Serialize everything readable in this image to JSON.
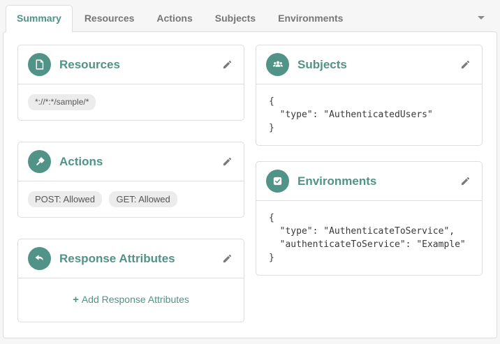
{
  "colors": {
    "accent": "#519387",
    "tab_inactive": "#767676",
    "badge_bg": "#ececec",
    "panel_bg": "#ffffff",
    "page_bg": "#f6f6f6"
  },
  "tabs": [
    {
      "label": "Summary",
      "active": true
    },
    {
      "label": "Resources",
      "active": false
    },
    {
      "label": "Actions",
      "active": false
    },
    {
      "label": "Subjects",
      "active": false
    },
    {
      "label": "Environments",
      "active": false
    }
  ],
  "tab_overflow_icon": "chevron-down-icon",
  "cards": {
    "resources": {
      "title": "Resources",
      "icon": "file-icon",
      "edit_icon": "pencil-icon",
      "badges": [
        "*://*:*/sample/*"
      ]
    },
    "actions": {
      "title": "Actions",
      "icon": "gavel-icon",
      "edit_icon": "pencil-icon",
      "badges": [
        "POST: Allowed",
        "GET: Allowed"
      ]
    },
    "response_attributes": {
      "title": "Response Attributes",
      "icon": "reply-arrow-icon",
      "edit_icon": "pencil-icon",
      "add_plus": "+",
      "add_label": "Add Response Attributes"
    },
    "subjects": {
      "title": "Subjects",
      "icon": "users-icon",
      "edit_icon": "pencil-icon",
      "json": "{\n  \"type\": \"AuthenticatedUsers\"\n}"
    },
    "environments": {
      "title": "Environments",
      "icon": "check-square-icon",
      "edit_icon": "pencil-icon",
      "json": "{\n  \"type\": \"AuthenticateToService\",\n  \"authenticateToService\": \"Example\"\n}"
    }
  }
}
